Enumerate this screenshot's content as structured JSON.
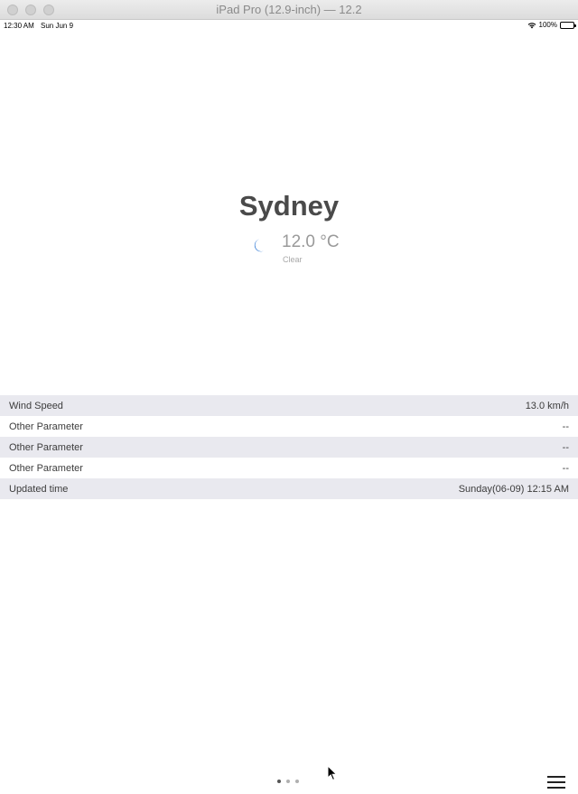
{
  "window": {
    "title": "iPad Pro (12.9-inch) — 12.2"
  },
  "status_bar": {
    "time": "12:30 AM",
    "date": "Sun Jun 9",
    "battery": "100%"
  },
  "weather": {
    "city": "Sydney",
    "icon": "moon-icon",
    "temperature": "12.0 °C",
    "condition": "Clear",
    "accent_color": "#1f6fd1"
  },
  "parameters": [
    {
      "label": "Wind Speed",
      "value": "13.0 km/h"
    },
    {
      "label": "Other Parameter",
      "value": "--"
    },
    {
      "label": "Other Parameter",
      "value": "--"
    },
    {
      "label": "Other Parameter",
      "value": "--"
    },
    {
      "label": "Updated time",
      "value": "Sunday(06-09) 12:15 AM"
    }
  ],
  "page_control": {
    "pages": 3,
    "current": 1
  }
}
